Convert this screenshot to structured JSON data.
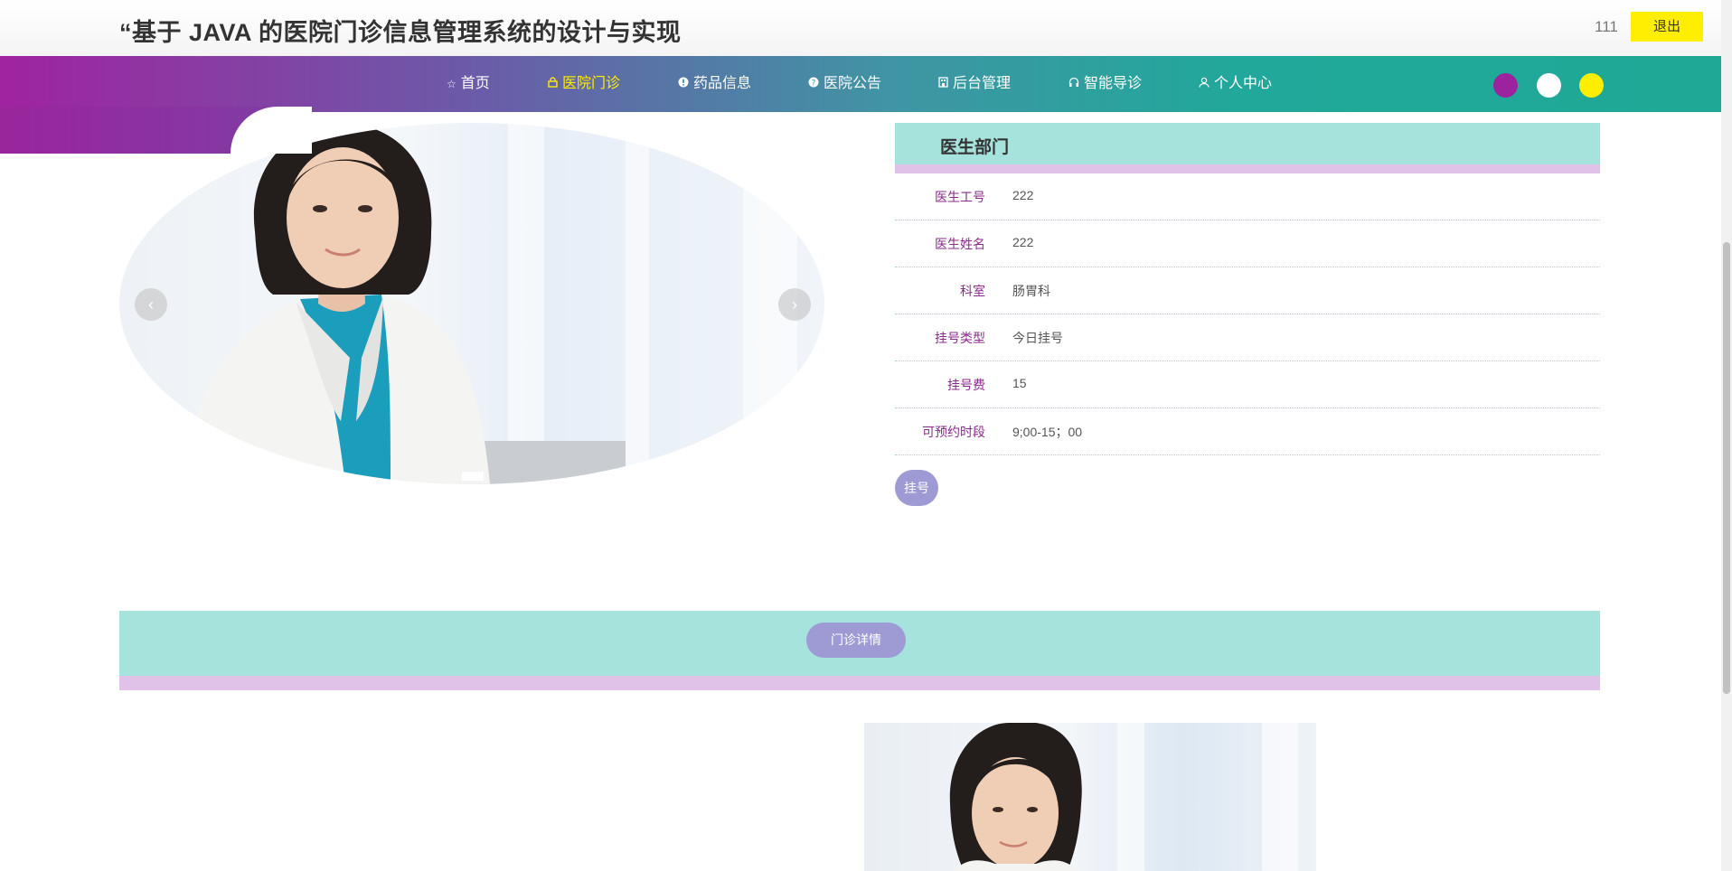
{
  "header": {
    "title": "“基于 JAVA 的医院门诊信息管理系统的设计与实现",
    "username": "111",
    "logout_label": "退出"
  },
  "nav": {
    "items": [
      {
        "label": "首页",
        "icon": "star-icon"
      },
      {
        "label": "医院门诊",
        "icon": "lock-icon",
        "active": true
      },
      {
        "label": "药品信息",
        "icon": "info-icon"
      },
      {
        "label": "医院公告",
        "icon": "question-icon"
      },
      {
        "label": "后台管理",
        "icon": "building-icon"
      },
      {
        "label": "智能导诊",
        "icon": "headset-icon"
      },
      {
        "label": "个人中心",
        "icon": "user-icon"
      }
    ],
    "theme_colors": [
      "#9b239e",
      "#ffffff",
      "#ffee00"
    ]
  },
  "carousel": {
    "prev_label": "‹",
    "next_label": "›",
    "image": "doctor-portrait"
  },
  "panel": {
    "title": "医生部门",
    "rows": [
      {
        "label": "医生工号",
        "value": "222"
      },
      {
        "label": "医生姓名",
        "value": "222"
      },
      {
        "label": "科室",
        "value": "肠胃科"
      },
      {
        "label": "挂号类型",
        "value": "今日挂号"
      },
      {
        "label": "挂号费",
        "value": "15"
      },
      {
        "label": "可预约时段",
        "value": "9;00-15；00"
      }
    ],
    "register_label": "挂号"
  },
  "details": {
    "button_label": "门诊详情",
    "image": "doctor-portrait"
  },
  "colors": {
    "accent_teal": "#a6e3dd",
    "accent_pink": "#e0c2e8",
    "button_purple": "#9e9ad4",
    "label_purple": "#8a2a8a",
    "logout_yellow": "#ffee00"
  }
}
